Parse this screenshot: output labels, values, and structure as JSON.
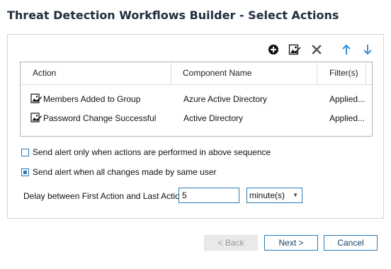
{
  "window": {
    "title": "Threat Detection Workflows Builder - Select Actions"
  },
  "toolbar": {
    "add": "plus-circle-icon",
    "edit": "edit-image-icon",
    "delete": "close-icon",
    "move_up": "arrow-up-icon",
    "move_down": "arrow-down-icon",
    "arrow_color": "#3d8fd6"
  },
  "grid": {
    "columns": [
      "Action",
      "Component Name",
      "Filter(s)"
    ],
    "rows": [
      {
        "action": "Members Added to Group",
        "component": "Azure Active Directory",
        "filters": "Applied..."
      },
      {
        "action": "Password Change Successful",
        "component": "Active Directory",
        "filters": "Applied..."
      }
    ]
  },
  "options": {
    "sequence_label": "Send alert only when actions are performed in above sequence",
    "sequence_checked": false,
    "same_user_label": "Send alert when all changes made by same user",
    "same_user_checked": true
  },
  "delay": {
    "label": "Delay between First Action and Last Action :",
    "value": "5",
    "unit": "minute(s)"
  },
  "footer": {
    "back": "< Back",
    "next": "Next >",
    "cancel": "Cancel"
  },
  "colors": {
    "accent": "#2a7ab8",
    "title": "#1f2d3d"
  }
}
